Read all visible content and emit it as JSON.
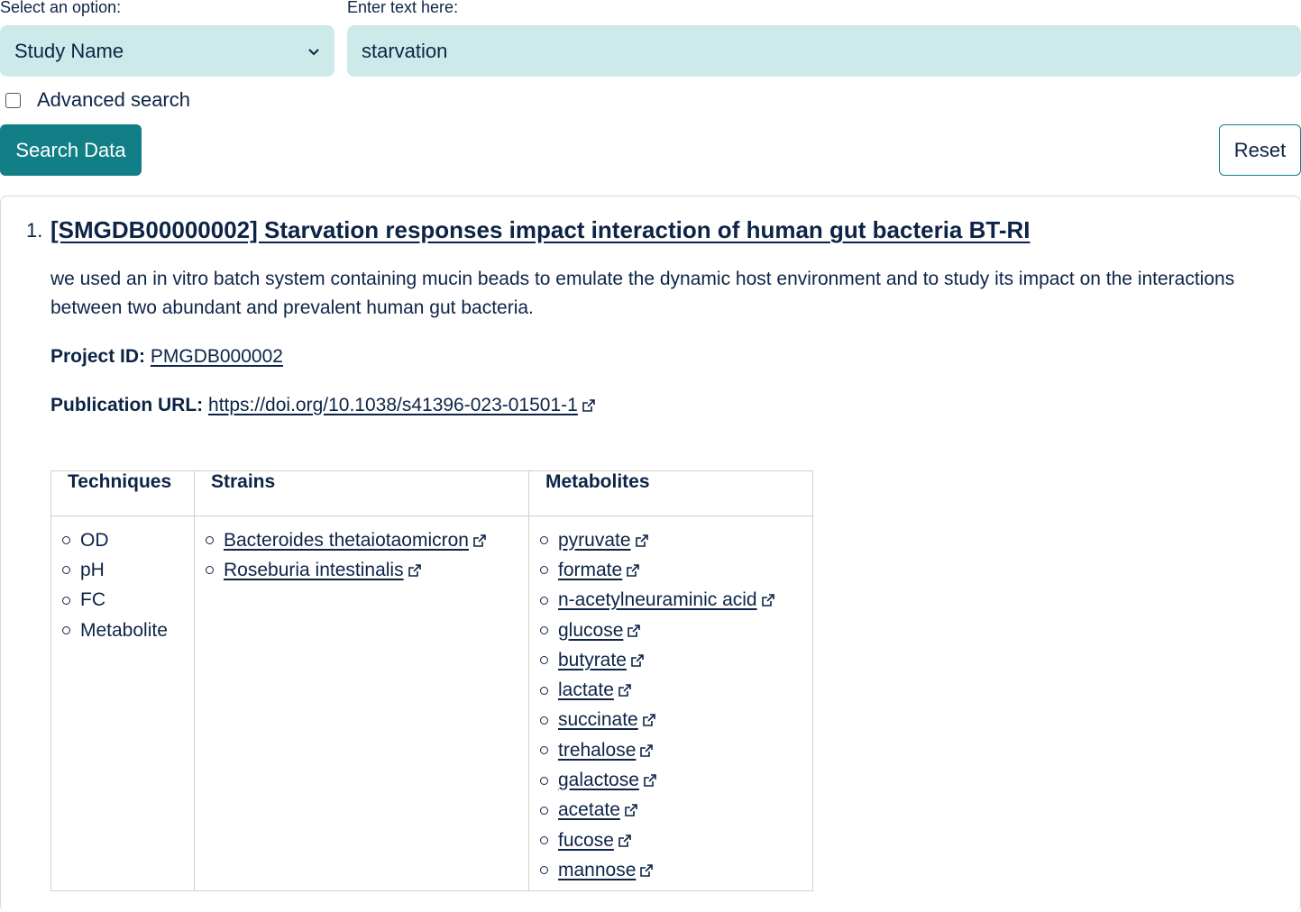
{
  "form": {
    "select_label": "Select an option:",
    "select_value": "Study Name",
    "text_label": "Enter text here:",
    "text_value": "starvation",
    "advanced_label": "Advanced search",
    "search_button": "Search Data",
    "reset_button": "Reset"
  },
  "result": {
    "number": "1.",
    "title": "[SMGDB00000002] Starvation responses impact interaction of human gut bacteria BT-RI",
    "description": "we used an in vitro batch system containing mucin beads to emulate the dynamic host environment and to study its impact on the interactions between two abundant and prevalent human gut bacteria.",
    "project_label": "Project ID:",
    "project_id": "PMGDB000002",
    "publication_label": "Publication URL:",
    "publication_url": "https://doi.org/10.1038/s41396-023-01501-1",
    "table": {
      "headers": [
        "Techniques",
        "Strains",
        "Metabolites"
      ],
      "techniques": [
        "OD",
        "pH",
        "FC",
        "Metabolite"
      ],
      "strains": [
        "Bacteroides thetaiotaomicron",
        "Roseburia intestinalis"
      ],
      "metabolites": [
        "pyruvate",
        "formate",
        "n-acetylneuraminic acid",
        "glucose",
        "butyrate",
        "lactate",
        "succinate",
        "trehalose",
        "galactose",
        "acetate",
        "fucose",
        "mannose"
      ]
    }
  }
}
